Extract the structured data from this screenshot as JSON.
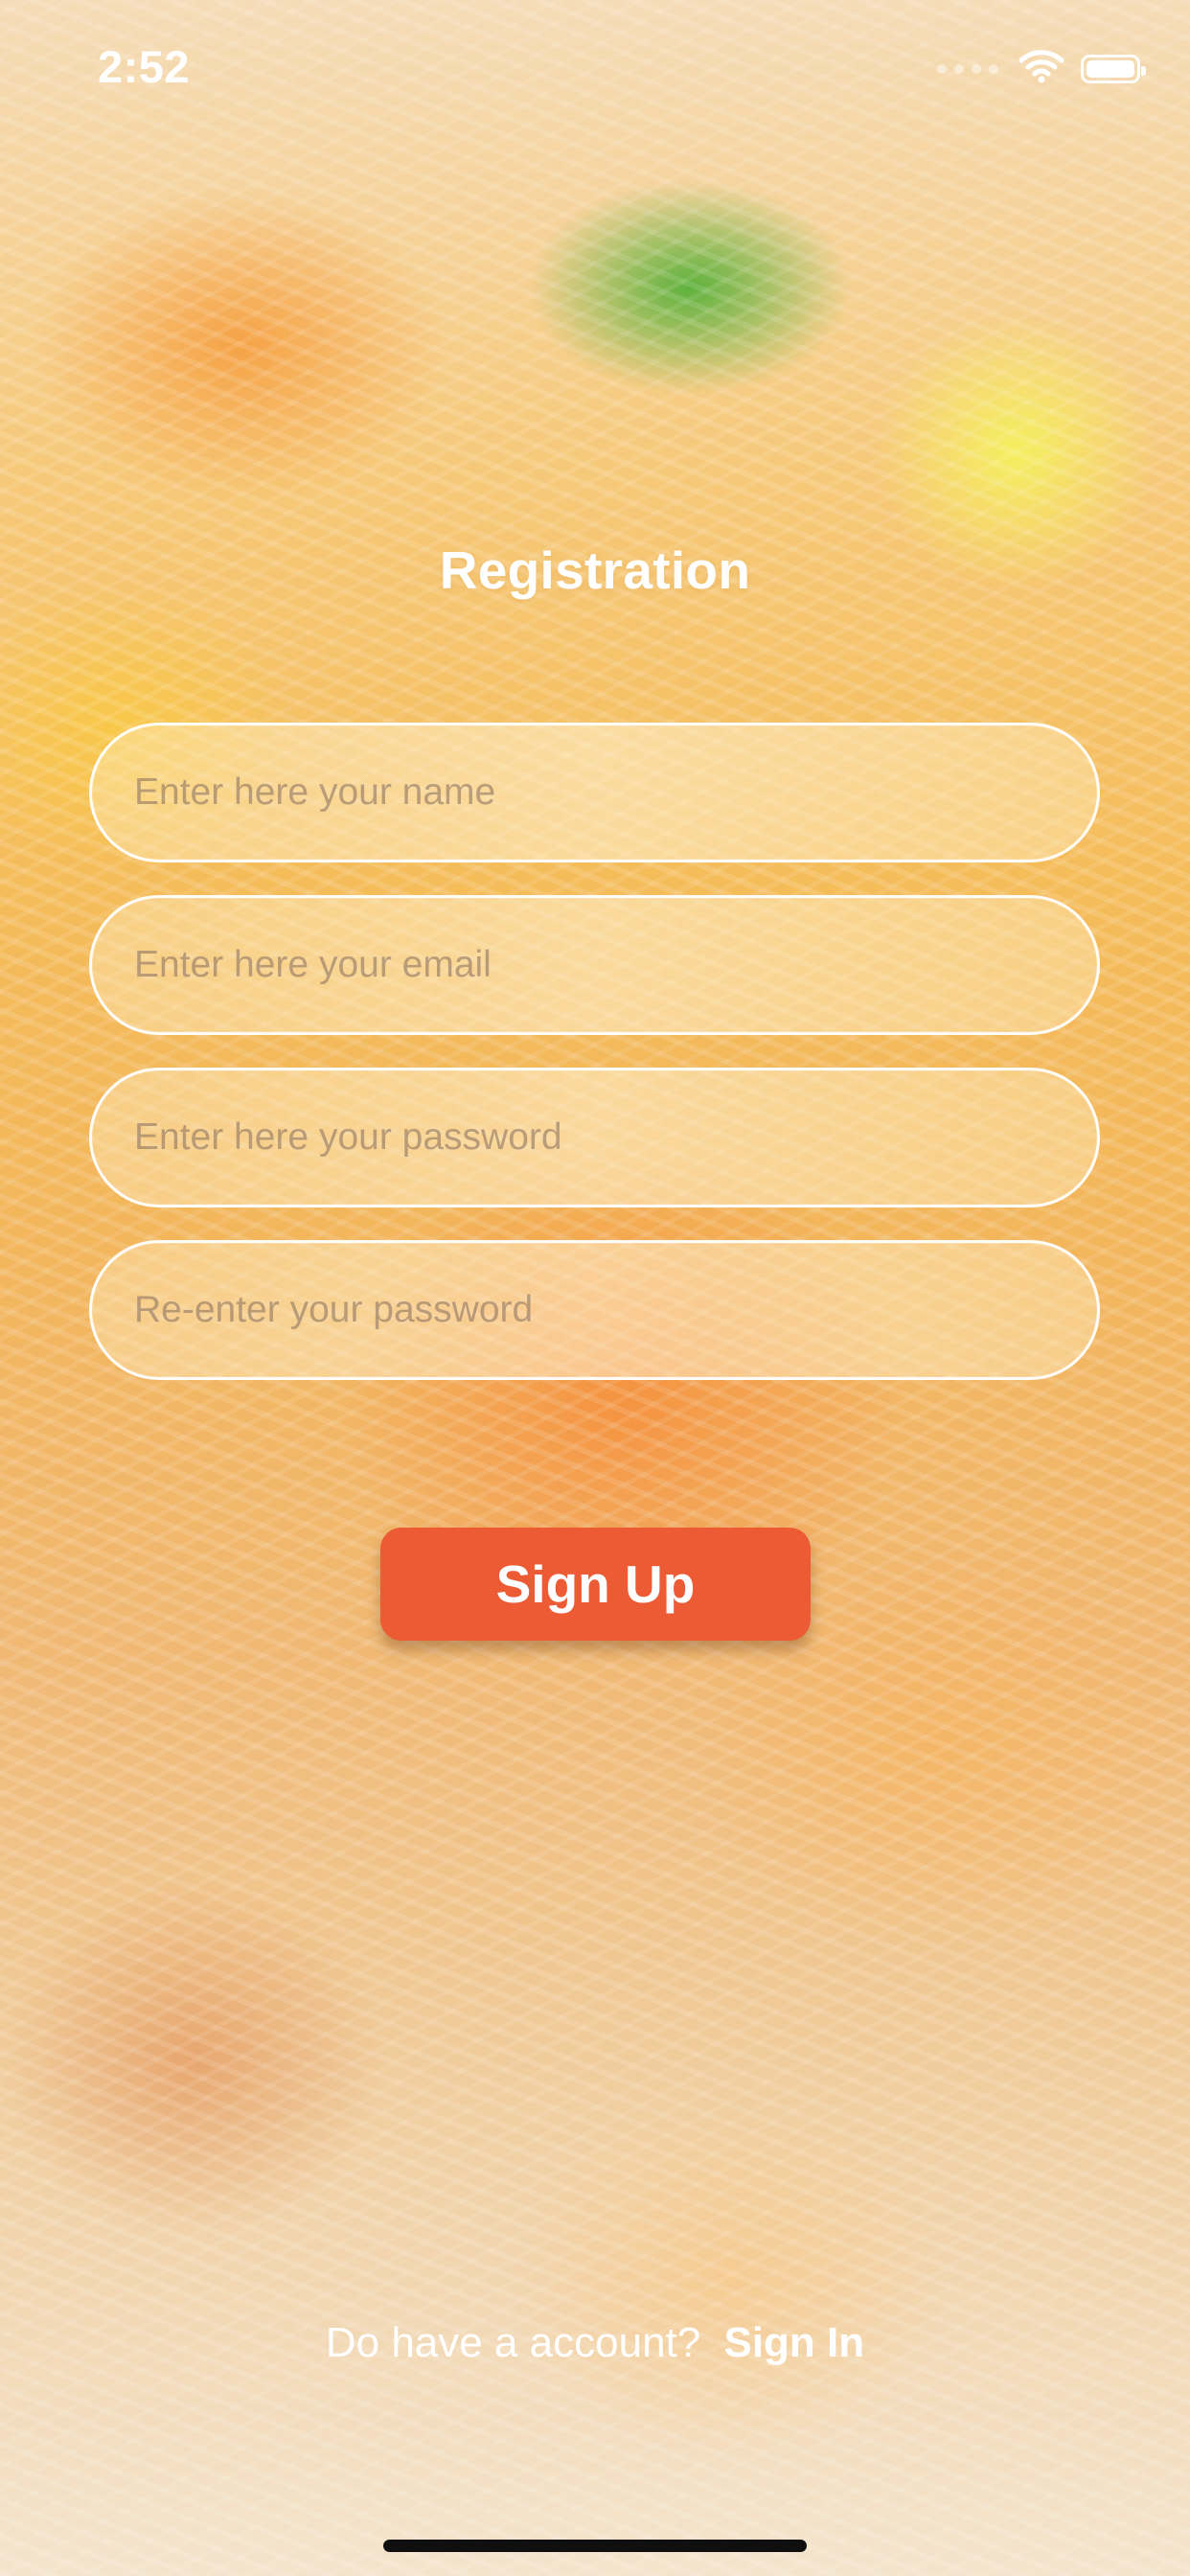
{
  "status_bar": {
    "time": "2:52",
    "icons": [
      "signal-dots-icon",
      "wifi-icon",
      "battery-icon"
    ]
  },
  "screen": {
    "title": "Registration"
  },
  "form": {
    "name_placeholder": "Enter here your name",
    "email_placeholder": "Enter here your email",
    "password_placeholder": "Enter here your password",
    "confirm_password_placeholder": "Re-enter your password"
  },
  "actions": {
    "sign_up_label": "Sign Up"
  },
  "footer": {
    "prompt": "Do have a account?",
    "sign_in_label": "Sign In"
  },
  "colors": {
    "primary_button": "#ec5b34",
    "text_on_image": "#ffffff"
  }
}
